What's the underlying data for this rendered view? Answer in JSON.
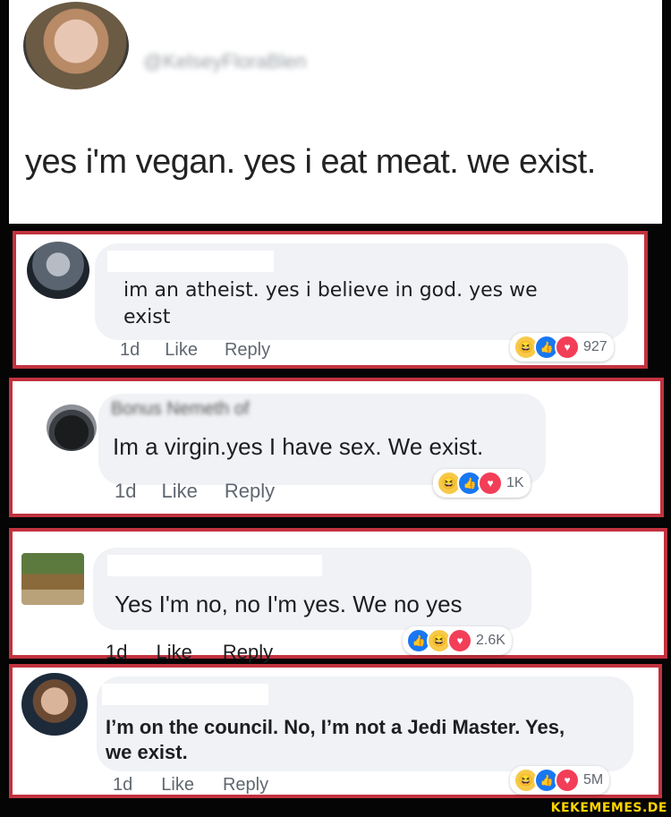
{
  "post": {
    "username_blurred": "@KelseyFloraBlen",
    "text": "yes i'm vegan. yes i eat meat. we exist."
  },
  "comments": [
    {
      "name_blurred": "",
      "text_lines": [
        "im an atheist.  yes i believe in god.  yes we",
        "exist"
      ],
      "time": "1d",
      "like": "Like",
      "reply": "Reply",
      "count": "927",
      "reactions": [
        "haha",
        "like",
        "love"
      ]
    },
    {
      "name_blurred": "Bonus Nemeth of",
      "text_lines": [
        "Im a virgin.yes I have sex. We exist."
      ],
      "time": "1d",
      "like": "Like",
      "reply": "Reply",
      "count": "1K",
      "reactions": [
        "haha",
        "like",
        "love"
      ]
    },
    {
      "name_blurred": "",
      "text_lines": [
        "Yes I'm no, no I'm yes. We no yes"
      ],
      "time": "1d",
      "like": "Like",
      "reply": "Reply",
      "count": "2.6K",
      "reactions": [
        "like",
        "haha",
        "love"
      ]
    },
    {
      "name_blurred": "",
      "text_lines": [
        "I’m on the council. No, I’m not a Jedi Master. Yes,",
        "we exist."
      ],
      "time": "1d",
      "like": "Like",
      "reply": "Reply",
      "count": "5M",
      "reactions": [
        "haha",
        "like",
        "love"
      ]
    }
  ],
  "colors": {
    "frame_red": "#c2323f",
    "like_blue": "#1877f2",
    "love_red": "#f33e58",
    "haha_yellow": "#f7c948"
  },
  "watermark": "KEKEMEMES.DE"
}
